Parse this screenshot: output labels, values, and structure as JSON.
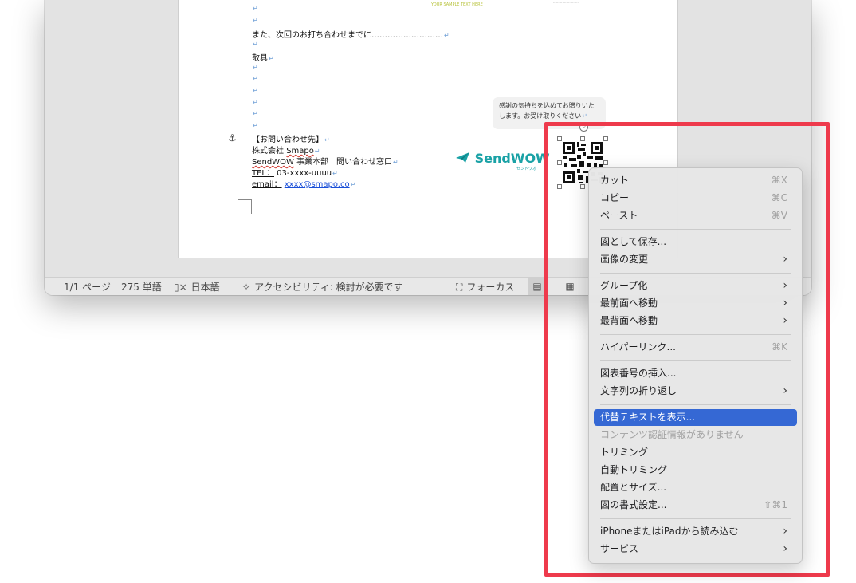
{
  "document": {
    "sample_caption": "YOUR SAMPLE TEXT HERE",
    "closing_line": "また、次回のお打ち合わせまでに………………………",
    "regards": "敬具",
    "contact_heading": "【お問い合わせ先】",
    "company_prefix": "株式会社 ",
    "company_name": "Smapo",
    "dept_brand": "SendWOW",
    "dept_rest": " 事業本部　問い合わせ窓口",
    "tel_label": "TEL：",
    "tel_value": " 03-xxxx-uuuu",
    "email_label": "email：",
    "email_value": "xxxx@smapo.co",
    "bubble_line1": "感謝の気持ちを込めてお贈りいた",
    "bubble_line2": "します。お受け取りください",
    "logo_text": "SendWOW",
    "logo_sub": "センドワオ",
    "paragraph_mark": "↵",
    "anchor_symbol": "⚓"
  },
  "statusbar": {
    "page_count": "1/1 ページ",
    "word_count": "275 単語",
    "language": "日本語",
    "accessibility": "アクセシビリティ: 検討が必要です",
    "focus": "フォーカス"
  },
  "context_menu": {
    "cut": {
      "label": "カット",
      "shortcut": "⌘X"
    },
    "copy": {
      "label": "コピー",
      "shortcut": "⌘C"
    },
    "paste": {
      "label": "ペースト",
      "shortcut": "⌘V"
    },
    "save_as_picture": {
      "label": "図として保存..."
    },
    "change_picture": {
      "label": "画像の変更"
    },
    "group": {
      "label": "グループ化"
    },
    "bring_to_front": {
      "label": "最前面へ移動"
    },
    "send_to_back": {
      "label": "最背面へ移動"
    },
    "hyperlink": {
      "label": "ハイパーリンク...",
      "shortcut": "⌘K"
    },
    "insert_caption": {
      "label": "図表番号の挿入..."
    },
    "wrap_text": {
      "label": "文字列の折り返し"
    },
    "view_alt_text": {
      "label": "代替テキストを表示..."
    },
    "no_content_credentials": {
      "label": "コンテンツ認証情報がありません"
    },
    "crop": {
      "label": "トリミング"
    },
    "auto_crop": {
      "label": "自動トリミング"
    },
    "position_size": {
      "label": "配置とサイズ..."
    },
    "format_picture": {
      "label": "図の書式設定...",
      "shortcut": "⇧⌘1"
    },
    "import_from_iphone": {
      "label": "iPhoneまたはiPadから読み込む"
    },
    "services": {
      "label": "サービス"
    }
  },
  "colors": {
    "highlight_border": "#ee3a4c",
    "menu_selected": "#3568d4",
    "logo": "#1aa2a6",
    "link": "#1a4fd8"
  }
}
